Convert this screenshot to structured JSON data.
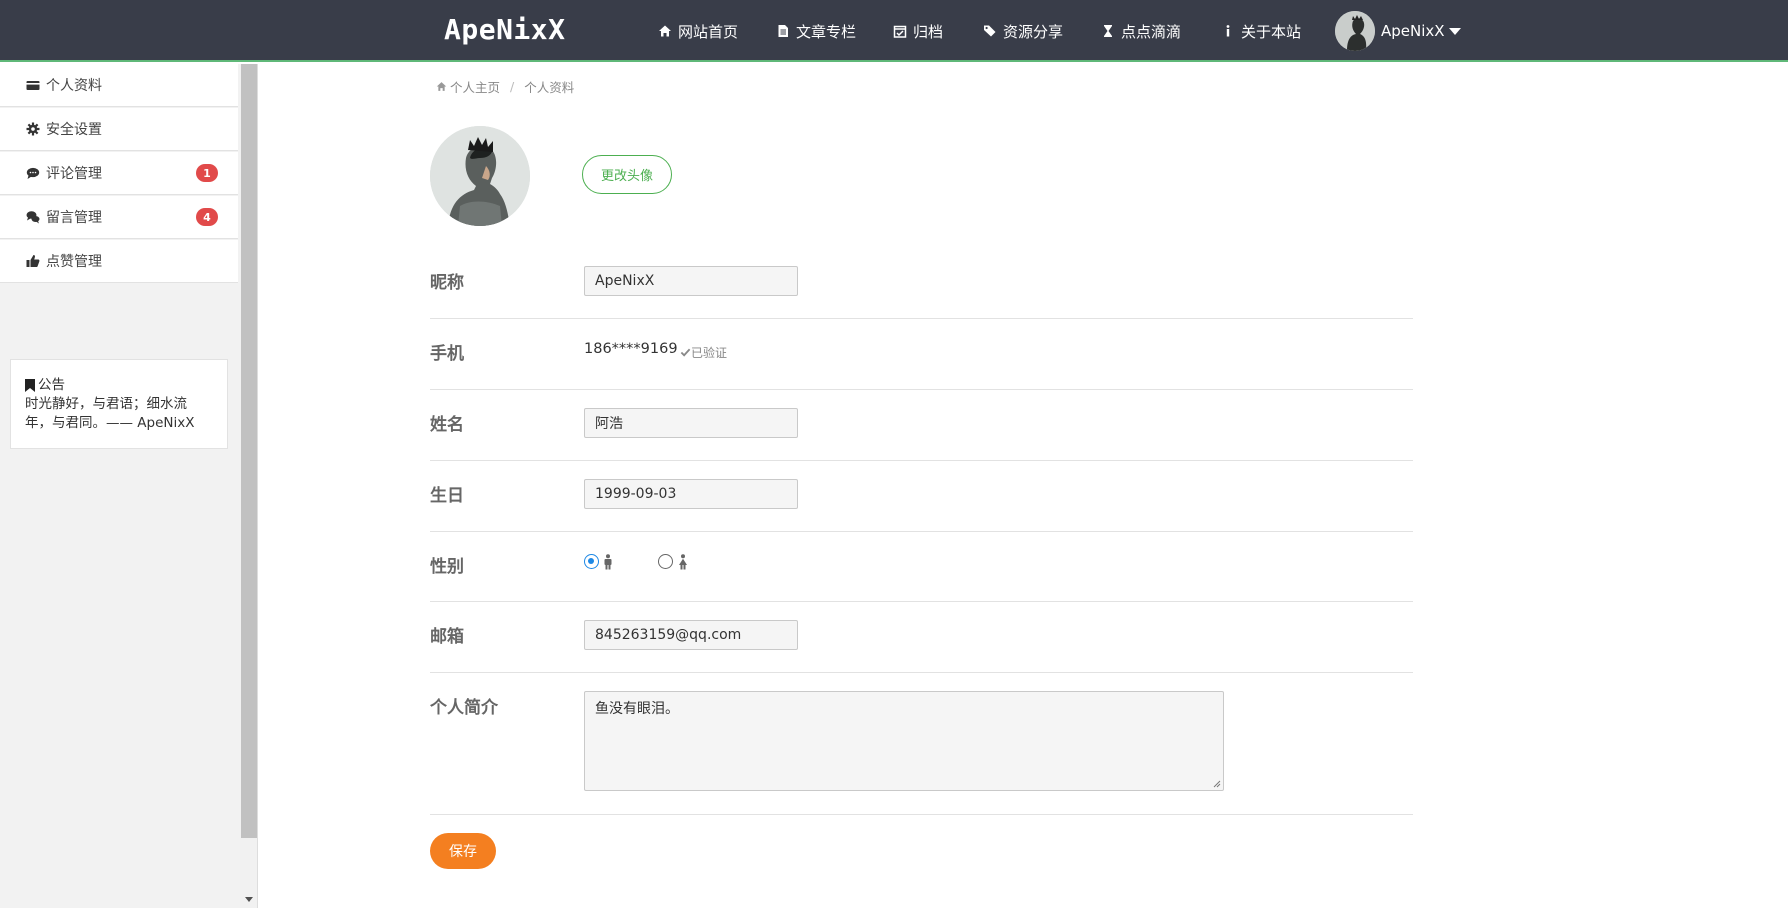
{
  "brand": "ApeNixX",
  "nav": [
    {
      "label": "网站首页",
      "icon": "home-icon"
    },
    {
      "label": "文章专栏",
      "icon": "file-text-icon"
    },
    {
      "label": "归档",
      "icon": "calendar-check-icon"
    },
    {
      "label": "资源分享",
      "icon": "tags-icon"
    },
    {
      "label": "点点滴滴",
      "icon": "hourglass-icon"
    },
    {
      "label": "关于本站",
      "icon": "info-icon"
    }
  ],
  "user": {
    "name": "ApeNixX"
  },
  "sidebar": {
    "items": [
      {
        "label": "个人资料",
        "icon": "credit-card-icon",
        "badge": ""
      },
      {
        "label": "安全设置",
        "icon": "gear-icon",
        "badge": ""
      },
      {
        "label": "评论管理",
        "icon": "comment-icon",
        "badge": "1"
      },
      {
        "label": "留言管理",
        "icon": "comments-icon",
        "badge": "4"
      },
      {
        "label": "点赞管理",
        "icon": "thumbs-up-icon",
        "badge": ""
      }
    ],
    "notice": {
      "title": "公告",
      "text": "时光静好，与君语；细水流年，与君同。—— ApeNixX"
    }
  },
  "breadcrumb": {
    "home": "个人主页",
    "sep": "/",
    "current": "个人资料"
  },
  "profile": {
    "change_avatar": "更改头像",
    "nickname_label": "昵称",
    "nickname": "ApeNixX",
    "phone_label": "手机",
    "phone": "186****9169",
    "verified": "已验证",
    "realname_label": "姓名",
    "realname": "阿浩",
    "birthday_label": "生日",
    "birthday": "1999-09-03",
    "gender_label": "性别",
    "gender_selected": "male",
    "email_label": "邮箱",
    "email": "845263159@qq.com",
    "bio_label": "个人简介",
    "bio": "鱼没有眼泪。",
    "save": "保存"
  },
  "colors": {
    "topbar": "#393d49",
    "accent_green": "#4caf50",
    "save_orange": "#f47f20",
    "badge_red": "#e14a4a",
    "radio_blue": "#1e88e5"
  }
}
